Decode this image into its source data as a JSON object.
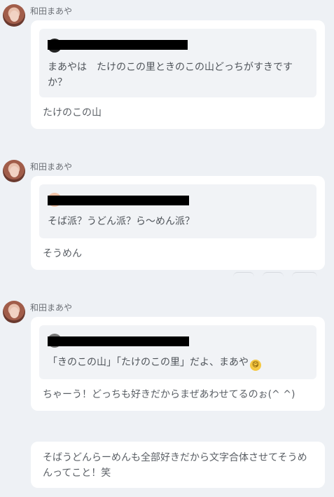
{
  "posts": [
    {
      "author": "和田まあや",
      "quote": "まあやは　たけのこの里ときのこの山どっちがすきですか？",
      "reply": "たけのこの山"
    },
    {
      "author": "和田まあや",
      "quote": "そば派？うどん派？ら〜めん派？",
      "reply": "そうめん"
    },
    {
      "author": "和田まあや",
      "quote": "「きのこの山」「たけのこの里」だよ、まあや",
      "quote_emoji": "😋",
      "reply": "ちゃーう！どっちも好きだからまぜあわせてるのぉ(^ ^)"
    }
  ],
  "followup": {
    "text": "そばうどんらーめんも全部好きだから文字合体させてそうめんってこと！笑"
  },
  "icons": [
    "avatar",
    "questioner-avatar",
    "redaction-bar"
  ]
}
